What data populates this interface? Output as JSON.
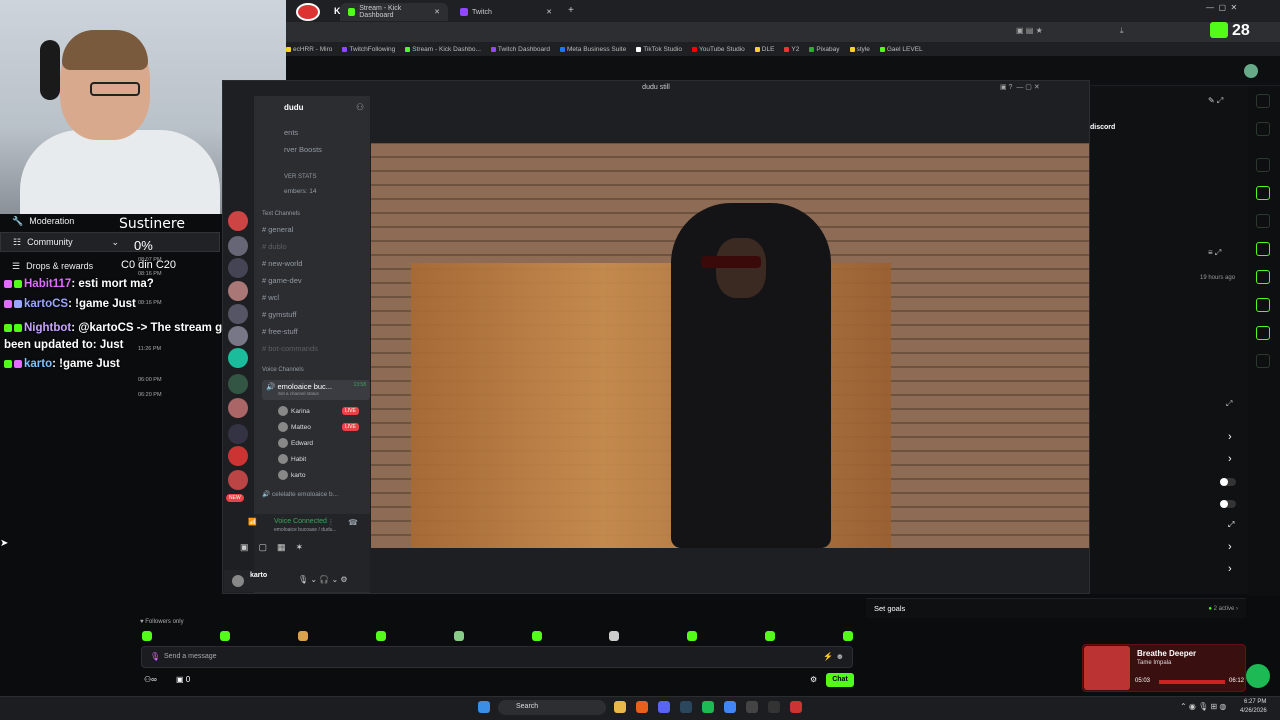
{
  "browser": {
    "profile_name": "Karina",
    "tabs": [
      {
        "label": "Stream - Kick Dashboard",
        "icon": "kick-icon",
        "active": true
      },
      {
        "label": "Twitch",
        "icon": "twitch-icon",
        "active": false
      }
    ],
    "bookmarks": [
      "ecHRR - Miro",
      "TwitchFollowing",
      "Stream - Kick Dashbo...",
      "Twitch Dashboard",
      "Meta Business Suite",
      "TikTok Studio",
      "YouTube Studio",
      "DLE",
      "Y2",
      "Pixabay",
      "style",
      "Gael LEVEL"
    ],
    "kick_count": "28"
  },
  "stream_overlay": {
    "sustinere_label": "Sustinere",
    "sustinere_pct": "0%",
    "goal_text": "C0 din C20",
    "nav": {
      "moderation": "Moderation",
      "community": "Community",
      "drops": "Drops & rewards"
    },
    "chat": [
      {
        "user": "Habit117",
        "message": ": esti mort ma?"
      },
      {
        "user": "kartoCS",
        "message": ": !game Just"
      },
      {
        "user": "Nightbot",
        "message": ": @kartoCS -> The stream game has been updated to: Just"
      },
      {
        "user": "karto",
        "message": ": !game Just"
      }
    ],
    "mini_times": [
      "08:07 PM",
      "08:16 PM",
      "08:16 PM",
      "11:26 PM",
      "06:00 PM",
      "06:20 PM"
    ]
  },
  "discord": {
    "window_title": "dudu still",
    "server_name": "dudu",
    "menu_items": [
      "ents",
      "rver Boosts"
    ],
    "stats_label": "VER STATS",
    "members_label": "embers: 14",
    "text_channels_label": "Text Channels",
    "channels": [
      "general",
      "dublo",
      "new-world",
      "game-dev",
      "wcl",
      "gymstuff",
      "free-stuff",
      "bot-commands"
    ],
    "voice_label": "Voice Channels",
    "voice_channel": "emoloaice buc...",
    "voice_time": "13:58",
    "voice_status": "Set a channel status",
    "voice_users": [
      {
        "name": "Karina",
        "live": "LIVE"
      },
      {
        "name": "Matteo",
        "live": "LIVE"
      },
      {
        "name": "Edward",
        "live": ""
      },
      {
        "name": "Habit",
        "live": ""
      },
      {
        "name": "karto",
        "live": ""
      }
    ],
    "voice_channel_2": "celelalte emoloaice b...",
    "voice_connected": "Voice Connected",
    "voice_connected_sub": "emoloaice bucoase / dudu...",
    "user": "karto",
    "server_badges": [
      "3",
      "NEW"
    ]
  },
  "dashboard": {
    "discord_label": "discord",
    "time_ago": "19 hours ago",
    "set_goals": "Set goals",
    "active_count": "2 active",
    "followers_only": "Followers only",
    "send_placeholder": "Send a message",
    "chat_button": "Chat",
    "viewers": "0",
    "accent": "#53fc18"
  },
  "spotify": {
    "title": "Breathe Deeper",
    "artist": "Tame Impala",
    "elapsed": "05:03",
    "total": "06:12"
  },
  "taskbar": {
    "search_label": "Search",
    "time": "6:27 PM",
    "date": "4/26/2026"
  }
}
